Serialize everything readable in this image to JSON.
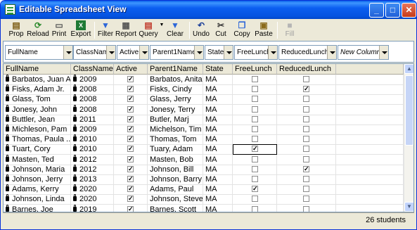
{
  "window": {
    "title": "Editable Spreadsheet View"
  },
  "titlebar_buttons": {
    "minimize": "_",
    "maximize": "□",
    "close": "✕"
  },
  "toolbar": {
    "prop": "Prop",
    "reload": "Reload",
    "print": "Print",
    "export": "Export",
    "filter": "Filter",
    "report": "Report",
    "query": "Query",
    "clear": "Clear",
    "undo": "Undo",
    "cut": "Cut",
    "copy": "Copy",
    "paste": "Paste",
    "fill": "Fill"
  },
  "column_selectors": [
    "FullName",
    "ClassName",
    "Active",
    "Parent1Name",
    "State",
    "FreeLunch",
    "ReducedLunch",
    "New Column"
  ],
  "columns": [
    "FullName",
    "ClassName",
    "Active",
    "Parent1Name",
    "State",
    "FreeLunch",
    "ReducedLunch"
  ],
  "rows": [
    {
      "name": "Barbatos, Juan A",
      "class": "2009",
      "active": true,
      "parent": "Barbatos, Anita",
      "state": "MA",
      "free": false,
      "reduced": false
    },
    {
      "name": "Fisks, Adam  Jr.",
      "class": "2008",
      "active": true,
      "parent": "Fisks, Cindy",
      "state": "MA",
      "free": false,
      "reduced": true
    },
    {
      "name": "Glass, Tom",
      "class": "2008",
      "active": true,
      "parent": "Glass, Jerry",
      "state": "MA",
      "free": false,
      "reduced": false
    },
    {
      "name": "Jonesy, John",
      "class": "2008",
      "active": true,
      "parent": "Jonesy, Terry",
      "state": "MA",
      "free": false,
      "reduced": false
    },
    {
      "name": "Buttler, Jean",
      "class": "2011",
      "active": true,
      "parent": "Butler, Marj",
      "state": "MA",
      "free": false,
      "reduced": false
    },
    {
      "name": "Michleson, Pam",
      "class": "2009",
      "active": true,
      "parent": "Michelson, Tim",
      "state": "MA",
      "free": false,
      "reduced": false
    },
    {
      "name": "Thomas, Paula ...",
      "class": "2010",
      "active": true,
      "parent": "Thomas, Tom",
      "state": "MA",
      "free": false,
      "reduced": false
    },
    {
      "name": "Tuart, Cory",
      "class": "2010",
      "active": true,
      "parent": "Tuary, Adam",
      "state": "MA",
      "free": true,
      "reduced": false,
      "focus": true
    },
    {
      "name": "Masten, Ted",
      "class": "2012",
      "active": true,
      "parent": "Masten, Bob",
      "state": "MA",
      "free": false,
      "reduced": false
    },
    {
      "name": "Johnson, Maria",
      "class": "2012",
      "active": true,
      "parent": "Johnson, Bill",
      "state": "MA",
      "free": false,
      "reduced": true
    },
    {
      "name": "Johnson, Jerry",
      "class": "2013",
      "active": true,
      "parent": "Johnson, Barry",
      "state": "MA",
      "free": false,
      "reduced": false
    },
    {
      "name": "Adams, Kerry",
      "class": "2020",
      "active": true,
      "parent": "Adams, Paul",
      "state": "MA",
      "free": true,
      "reduced": false
    },
    {
      "name": "Johnson, Linda",
      "class": "2020",
      "active": true,
      "parent": "Johnson, Steve",
      "state": "MA",
      "free": false,
      "reduced": false
    },
    {
      "name": "Barnes, Joe",
      "class": "2019",
      "active": true,
      "parent": "Barnes, Scott",
      "state": "MA",
      "free": false,
      "reduced": false
    }
  ],
  "check_mark": "✓",
  "scroll": {
    "up": "▲",
    "down": "▼"
  },
  "status": {
    "count_text": "26 students"
  }
}
